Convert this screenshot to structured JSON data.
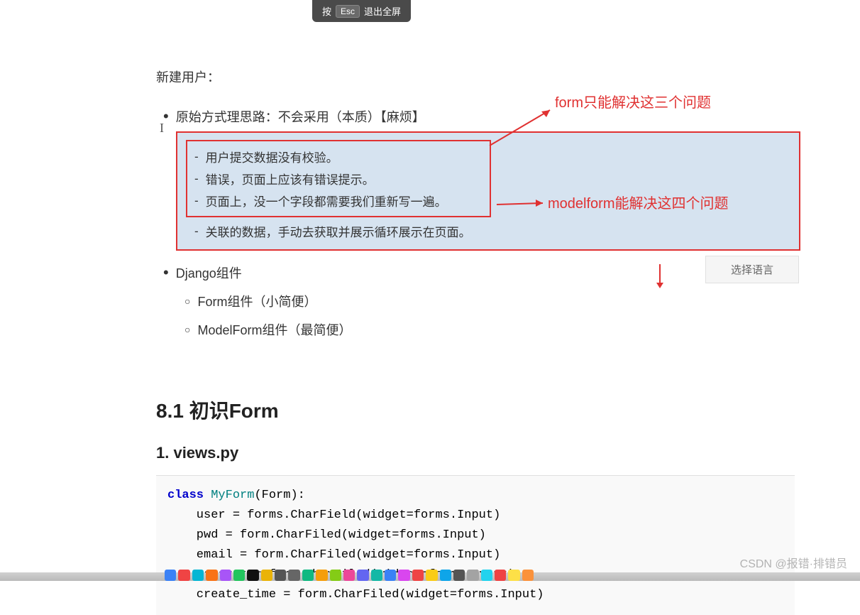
{
  "escBar": {
    "pre": "按",
    "key": "Esc",
    "post": "退出全屏"
  },
  "sectionTitle": "新建用户：",
  "bulletOriginal": "原始方式理思路：不会采用（本质）【麻烦】",
  "innerLines": [
    "用户提交数据没有校验。",
    "错误，页面上应该有错误提示。",
    "页面上，没一个字段都需要我们重新写一遍。"
  ],
  "outerLine": "关联的数据，手动去获取并展示循环展示在页面。",
  "langSelect": "选择语言",
  "componentBullet": "Django组件",
  "subBullets": [
    "Form组件（小简便）",
    "ModelForm组件（最简便）"
  ],
  "h2": "8.1 初识Form",
  "h3": "1. views.py",
  "code": {
    "l1a": "class",
    "l1b": "MyForm",
    "l1c": "(Form):",
    "l2": "    user = forms.CharField(widget=forms.Input)",
    "l3": "    pwd = form.CharFiled(widget=forms.Input)",
    "l4": "    email = form.CharFiled(widget=forms.Input)",
    "l5": "    account = form.CharFiled(widget=forms.Input)",
    "l6": "    create_time = form.CharFiled(widget=forms.Input)"
  },
  "annotation1": "form只能解决这三个问题",
  "annotation2": "modelform能解决这四个问题",
  "watermark": "CSDN @报错·排错员",
  "dockColors": [
    "#3b82f6",
    "#ef4444",
    "#06b6d4",
    "#f97316",
    "#a855f7",
    "#22c55e",
    "#111",
    "#eab308",
    "#555",
    "#666",
    "#10b981",
    "#f59e0b",
    "#84cc16",
    "#ec4899",
    "#6366f1",
    "#14b8a6",
    "#3b82f6",
    "#d946ef",
    "#ef4444",
    "#facc15",
    "#0ea5e9",
    "#555",
    "#a3a3a3",
    "#22d3ee",
    "#ef4444",
    "#fde047",
    "#fb923c"
  ]
}
